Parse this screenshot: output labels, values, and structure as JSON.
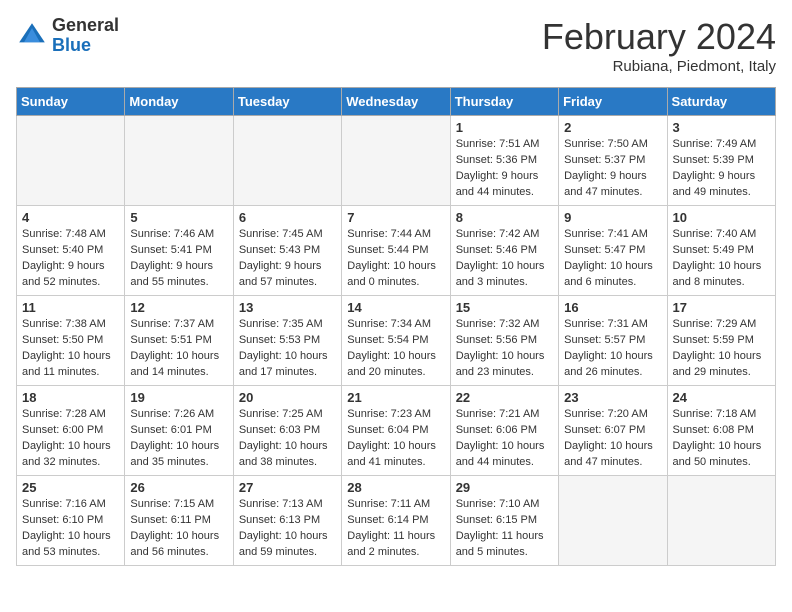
{
  "header": {
    "logo_general": "General",
    "logo_blue": "Blue",
    "title": "February 2024",
    "location": "Rubiana, Piedmont, Italy"
  },
  "days_of_week": [
    "Sunday",
    "Monday",
    "Tuesday",
    "Wednesday",
    "Thursday",
    "Friday",
    "Saturday"
  ],
  "weeks": [
    [
      {
        "num": "",
        "info": "",
        "empty": true
      },
      {
        "num": "",
        "info": "",
        "empty": true
      },
      {
        "num": "",
        "info": "",
        "empty": true
      },
      {
        "num": "",
        "info": "",
        "empty": true
      },
      {
        "num": "1",
        "info": "Sunrise: 7:51 AM\nSunset: 5:36 PM\nDaylight: 9 hours\nand 44 minutes."
      },
      {
        "num": "2",
        "info": "Sunrise: 7:50 AM\nSunset: 5:37 PM\nDaylight: 9 hours\nand 47 minutes."
      },
      {
        "num": "3",
        "info": "Sunrise: 7:49 AM\nSunset: 5:39 PM\nDaylight: 9 hours\nand 49 minutes."
      }
    ],
    [
      {
        "num": "4",
        "info": "Sunrise: 7:48 AM\nSunset: 5:40 PM\nDaylight: 9 hours\nand 52 minutes."
      },
      {
        "num": "5",
        "info": "Sunrise: 7:46 AM\nSunset: 5:41 PM\nDaylight: 9 hours\nand 55 minutes."
      },
      {
        "num": "6",
        "info": "Sunrise: 7:45 AM\nSunset: 5:43 PM\nDaylight: 9 hours\nand 57 minutes."
      },
      {
        "num": "7",
        "info": "Sunrise: 7:44 AM\nSunset: 5:44 PM\nDaylight: 10 hours\nand 0 minutes."
      },
      {
        "num": "8",
        "info": "Sunrise: 7:42 AM\nSunset: 5:46 PM\nDaylight: 10 hours\nand 3 minutes."
      },
      {
        "num": "9",
        "info": "Sunrise: 7:41 AM\nSunset: 5:47 PM\nDaylight: 10 hours\nand 6 minutes."
      },
      {
        "num": "10",
        "info": "Sunrise: 7:40 AM\nSunset: 5:49 PM\nDaylight: 10 hours\nand 8 minutes."
      }
    ],
    [
      {
        "num": "11",
        "info": "Sunrise: 7:38 AM\nSunset: 5:50 PM\nDaylight: 10 hours\nand 11 minutes."
      },
      {
        "num": "12",
        "info": "Sunrise: 7:37 AM\nSunset: 5:51 PM\nDaylight: 10 hours\nand 14 minutes."
      },
      {
        "num": "13",
        "info": "Sunrise: 7:35 AM\nSunset: 5:53 PM\nDaylight: 10 hours\nand 17 minutes."
      },
      {
        "num": "14",
        "info": "Sunrise: 7:34 AM\nSunset: 5:54 PM\nDaylight: 10 hours\nand 20 minutes."
      },
      {
        "num": "15",
        "info": "Sunrise: 7:32 AM\nSunset: 5:56 PM\nDaylight: 10 hours\nand 23 minutes."
      },
      {
        "num": "16",
        "info": "Sunrise: 7:31 AM\nSunset: 5:57 PM\nDaylight: 10 hours\nand 26 minutes."
      },
      {
        "num": "17",
        "info": "Sunrise: 7:29 AM\nSunset: 5:59 PM\nDaylight: 10 hours\nand 29 minutes."
      }
    ],
    [
      {
        "num": "18",
        "info": "Sunrise: 7:28 AM\nSunset: 6:00 PM\nDaylight: 10 hours\nand 32 minutes."
      },
      {
        "num": "19",
        "info": "Sunrise: 7:26 AM\nSunset: 6:01 PM\nDaylight: 10 hours\nand 35 minutes."
      },
      {
        "num": "20",
        "info": "Sunrise: 7:25 AM\nSunset: 6:03 PM\nDaylight: 10 hours\nand 38 minutes."
      },
      {
        "num": "21",
        "info": "Sunrise: 7:23 AM\nSunset: 6:04 PM\nDaylight: 10 hours\nand 41 minutes."
      },
      {
        "num": "22",
        "info": "Sunrise: 7:21 AM\nSunset: 6:06 PM\nDaylight: 10 hours\nand 44 minutes."
      },
      {
        "num": "23",
        "info": "Sunrise: 7:20 AM\nSunset: 6:07 PM\nDaylight: 10 hours\nand 47 minutes."
      },
      {
        "num": "24",
        "info": "Sunrise: 7:18 AM\nSunset: 6:08 PM\nDaylight: 10 hours\nand 50 minutes."
      }
    ],
    [
      {
        "num": "25",
        "info": "Sunrise: 7:16 AM\nSunset: 6:10 PM\nDaylight: 10 hours\nand 53 minutes."
      },
      {
        "num": "26",
        "info": "Sunrise: 7:15 AM\nSunset: 6:11 PM\nDaylight: 10 hours\nand 56 minutes."
      },
      {
        "num": "27",
        "info": "Sunrise: 7:13 AM\nSunset: 6:13 PM\nDaylight: 10 hours\nand 59 minutes."
      },
      {
        "num": "28",
        "info": "Sunrise: 7:11 AM\nSunset: 6:14 PM\nDaylight: 11 hours\nand 2 minutes."
      },
      {
        "num": "29",
        "info": "Sunrise: 7:10 AM\nSunset: 6:15 PM\nDaylight: 11 hours\nand 5 minutes."
      },
      {
        "num": "",
        "info": "",
        "empty": true
      },
      {
        "num": "",
        "info": "",
        "empty": true
      }
    ]
  ]
}
